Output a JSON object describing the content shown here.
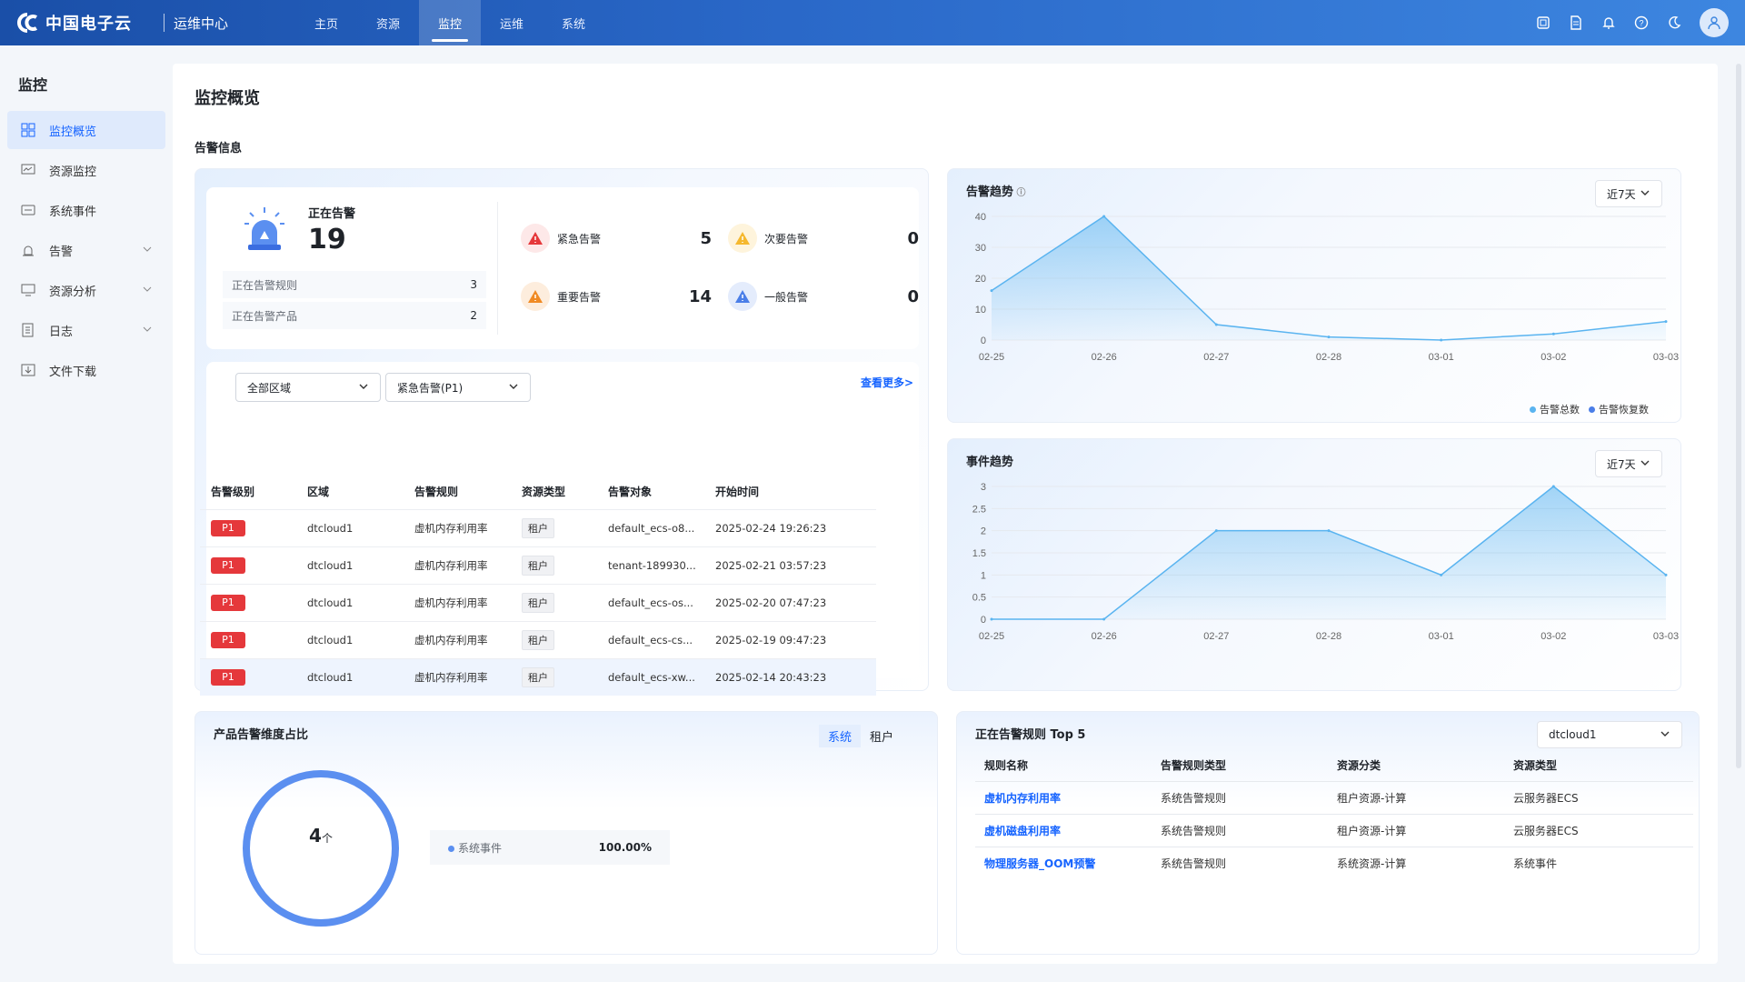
{
  "header": {
    "brand": "中国电子云",
    "subtitle": "运维中心",
    "nav": [
      {
        "label": "主页"
      },
      {
        "label": "资源"
      },
      {
        "label": "监控"
      },
      {
        "label": "运维"
      },
      {
        "label": "系统"
      }
    ],
    "accent": "#1664ff"
  },
  "sidebar": {
    "title": "监控",
    "items": [
      {
        "label": "监控概览",
        "icon": "grid-icon"
      },
      {
        "label": "资源监控",
        "icon": "monitor-icon"
      },
      {
        "label": "系统事件",
        "icon": "event-icon"
      },
      {
        "label": "告警",
        "icon": "alarm-icon"
      },
      {
        "label": "资源分析",
        "icon": "analysis-icon"
      },
      {
        "label": "日志",
        "icon": "log-icon"
      },
      {
        "label": "文件下载",
        "icon": "download-icon"
      }
    ]
  },
  "page": {
    "title": "监控概览",
    "section": "告警信息"
  },
  "alarm_summary": {
    "label": "正在告警",
    "count": "19",
    "rules_label": "正在告警规则",
    "rules_count": "3",
    "products_label": "正在告警产品",
    "products_count": "2",
    "severities": [
      {
        "label": "紧急告警",
        "count": "5",
        "color": "#e5383b"
      },
      {
        "label": "次要告警",
        "count": "0",
        "color": "#f5b82e"
      },
      {
        "label": "重要告警",
        "count": "14",
        "color": "#f08a24"
      },
      {
        "label": "一般告警",
        "count": "0",
        "color": "#4a7ee8"
      }
    ]
  },
  "alarm_list": {
    "region_select": "全部区域",
    "level_select": "紧急告警(P1)",
    "more": "查看更多>",
    "columns": [
      "告警级别",
      "区域",
      "告警规则",
      "资源类型",
      "告警对象",
      "开始时间"
    ],
    "rows": [
      {
        "level": "P1",
        "region": "dtcloud1",
        "rule": "虚机内存利用率",
        "type": "租户",
        "target": "default_ecs-o8...",
        "time": "2025-02-24 19:26:23"
      },
      {
        "level": "P1",
        "region": "dtcloud1",
        "rule": "虚机内存利用率",
        "type": "租户",
        "target": "tenant-189930...",
        "time": "2025-02-21 03:57:23"
      },
      {
        "level": "P1",
        "region": "dtcloud1",
        "rule": "虚机内存利用率",
        "type": "租户",
        "target": "default_ecs-os...",
        "time": "2025-02-20 07:47:23"
      },
      {
        "level": "P1",
        "region": "dtcloud1",
        "rule": "虚机内存利用率",
        "type": "租户",
        "target": "default_ecs-cs...",
        "time": "2025-02-19 09:47:23"
      },
      {
        "level": "P1",
        "region": "dtcloud1",
        "rule": "虚机内存利用率",
        "type": "租户",
        "target": "default_ecs-xw...",
        "time": "2025-02-14 20:43:23"
      }
    ]
  },
  "alarm_trend": {
    "title": "告警趋势",
    "range": "近7天"
  },
  "event_trend": {
    "title": "事件趋势",
    "range": "近7天"
  },
  "chart_data": [
    {
      "type": "area",
      "title": "告警趋势",
      "x": [
        "02-25",
        "02-26",
        "02-27",
        "02-28",
        "03-01",
        "03-02",
        "03-03"
      ],
      "ylim": [
        0,
        40
      ],
      "yticks": [
        "0",
        "10",
        "20",
        "30",
        "40"
      ],
      "series": [
        {
          "name": "告警总数",
          "values": [
            16,
            40,
            5,
            1,
            0,
            2,
            6
          ],
          "color": "#5ab4f0"
        },
        {
          "name": "告警恢复数",
          "values": [
            0,
            0,
            0,
            0,
            0,
            0,
            0
          ],
          "color": "#4a7ee8"
        }
      ],
      "legend": "bottom-right"
    },
    {
      "type": "area",
      "title": "事件趋势",
      "x": [
        "02-25",
        "02-26",
        "02-27",
        "02-28",
        "03-01",
        "03-02",
        "03-03"
      ],
      "ylim": [
        0,
        3
      ],
      "yticks": [
        "0",
        "0.5",
        "1",
        "1.5",
        "2",
        "2.5",
        "3"
      ],
      "series": [
        {
          "values": [
            0,
            0,
            2,
            2,
            1,
            3,
            1
          ],
          "color": "#5ab4f0"
        }
      ]
    }
  ],
  "product_ratio": {
    "title": "产品告警维度占比",
    "tabs": [
      "系统",
      "租户"
    ],
    "total": "4",
    "unit": "个",
    "legend": [
      {
        "label": "系统事件",
        "value": "100.00%",
        "color": "#5b8ff0"
      }
    ]
  },
  "top_rules": {
    "title": "正在告警规则 Top 5",
    "region": "dtcloud1",
    "columns": [
      "规则名称",
      "告警规则类型",
      "资源分类",
      "资源类型"
    ],
    "rows": [
      {
        "name": "虚机内存利用率",
        "kind": "系统告警规则",
        "category": "租户资源-计算",
        "type": "云服务器ECS"
      },
      {
        "name": "虚机磁盘利用率",
        "kind": "系统告警规则",
        "category": "租户资源-计算",
        "type": "云服务器ECS"
      },
      {
        "name": "物理服务器_OOM预警",
        "kind": "系统告警规则",
        "category": "系统资源-计算",
        "type": "系统事件"
      }
    ]
  }
}
